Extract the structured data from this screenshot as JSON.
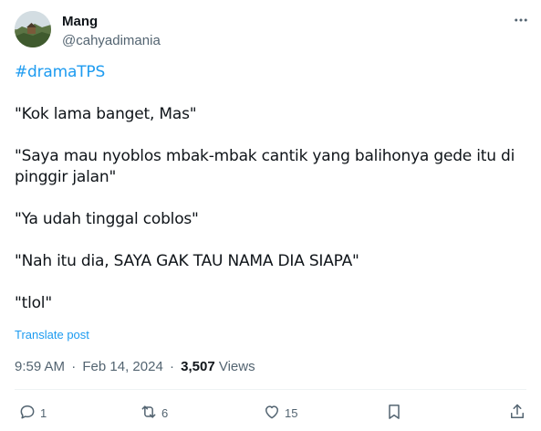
{
  "author": {
    "display_name": "Mang",
    "handle": "@cahyadimania"
  },
  "tweet": {
    "hashtag": "#dramaTPS",
    "lines": [
      "\"Kok lama banget, Mas\"",
      "\"Saya mau nyoblos mbak-mbak cantik yang balihonya gede itu di pinggir jalan\"",
      "\"Ya udah tinggal coblos\"",
      "\"Nah itu dia, SAYA GAK TAU NAMA DIA SIAPA\"",
      "\"tlol\""
    ],
    "translate_label": "Translate post"
  },
  "meta": {
    "time": "9:59 AM",
    "separator": "·",
    "date": "Feb 14, 2024",
    "views_count": "3,507",
    "views_label": "Views"
  },
  "actions": {
    "replies": "1",
    "reposts": "6",
    "likes": "15"
  },
  "icons": {
    "more": "more-horizontal-icon",
    "reply": "reply-icon",
    "repost": "repost-icon",
    "like": "heart-icon",
    "bookmark": "bookmark-icon",
    "share": "share-icon"
  },
  "colors": {
    "link": "#1d9bf0",
    "secondary_text": "#536471",
    "primary_text": "#0f1419"
  }
}
